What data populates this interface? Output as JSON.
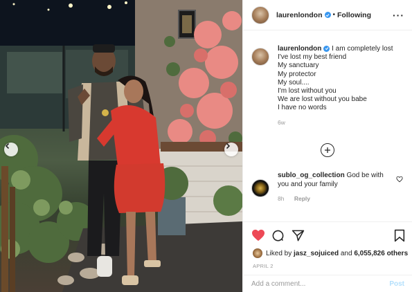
{
  "post": {
    "username": "laurenlondon",
    "follow_status": "Following",
    "caption_lines": [
      "I am completely lost",
      "I've lost my best friend",
      "My sanctuary",
      "My protector",
      "My soul....",
      "I'm lost without you",
      "We are lost without you babe",
      "I have no words"
    ],
    "caption_time": "6w"
  },
  "comment": {
    "username": "sublo_og_collection",
    "text": "God be with you and your family",
    "time": "8h",
    "reply_label": "Reply"
  },
  "truncated_comment": "...",
  "likes": {
    "prefix": "Liked by",
    "user": "jasz_sojuiced",
    "joiner": "and",
    "others": "6,055,826 others"
  },
  "date": "APRIL 2",
  "add_comment": {
    "placeholder": "Add a comment...",
    "post_label": "Post"
  },
  "icons": {
    "like": "heart-filled-icon",
    "comment": "comment-bubble-icon",
    "share": "share-paper-plane-icon",
    "save": "bookmark-icon",
    "more": "more-options-icon",
    "load_more": "plus-circle-icon",
    "prev": "chevron-left-icon",
    "next": "chevron-right-icon"
  },
  "colors": {
    "like_red": "#ed4956",
    "verified_blue": "#3897f0",
    "post_button": "#b2dffc",
    "meta_gray": "#999999"
  }
}
